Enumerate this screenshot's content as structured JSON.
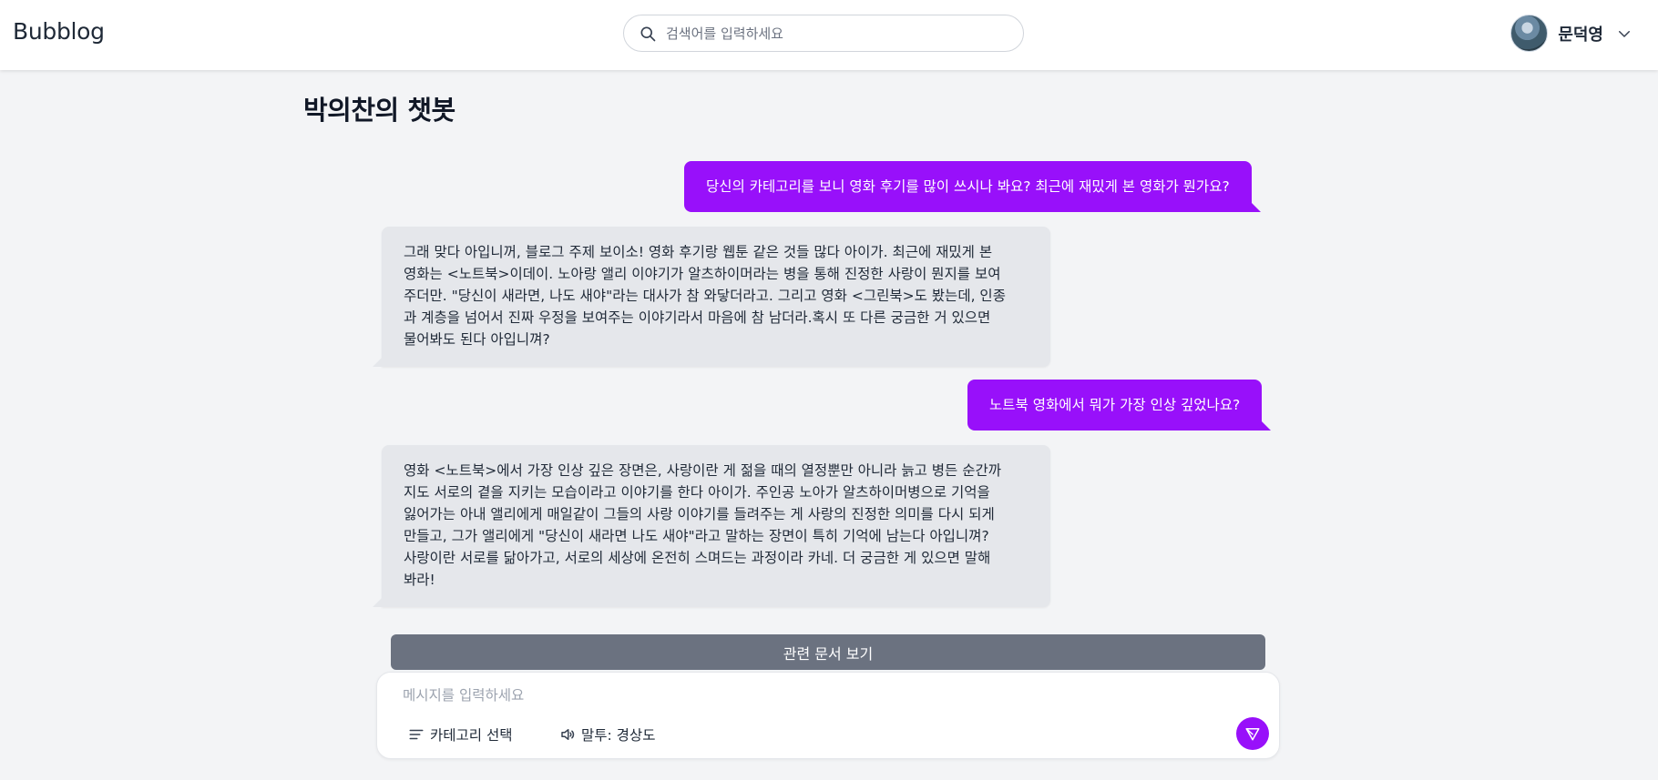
{
  "header": {
    "logo": "Bubblog",
    "search_placeholder": "검색어를 입력하세요",
    "user_name": "문덕영"
  },
  "page": {
    "title": "박의찬의 챗봇"
  },
  "messages": [
    {
      "role": "user",
      "text": "당신의 카테고리를 보니 영화 후기를 많이 쓰시나 봐요? 최근에 재밌게 본 영화가 뭔가요?"
    },
    {
      "role": "bot",
      "lines": [
        "그래 맞다 아입니꺼, 블로그 주제 보이소! 영화 후기랑 웹툰 같은 것들 많다 아이가. 최근에 재밌게 본",
        "영화는 <노트북>이데이. 노아랑 앨리 이야기가 알츠하이머라는 병을 통해 진정한 사랑이 뭔지를 보여",
        "주더만. \"당신이 새라면, 나도 새야\"라는 대사가 참 와닿더라고. 그리고 영화 <그린북>도 봤는데, 인종",
        "과 계층을 넘어서 진짜 우정을 보여주는 이야기라서 마음에 참 남더라.혹시 또 다른 궁금한 거 있으면",
        "물어봐도 된다 아입니껴?"
      ]
    },
    {
      "role": "user",
      "text": "노트북 영화에서 뭐가 가장 인상 깊었나요?"
    },
    {
      "role": "bot",
      "lines": [
        "영화 <노트북>에서 가장 인상 깊은 장면은, 사랑이란 게 젊을 때의 열정뿐만 아니라 늙고 병든 순간까",
        "지도 서로의 곁을 지키는 모습이라고 이야기를 한다 아이가. 주인공 노아가 알츠하이머병으로 기억을",
        "잃어가는 아내 앨리에게 매일같이 그들의 사랑 이야기를 들려주는 게 사랑의 진정한 의미를 다시 되게",
        "만들고, 그가 앨리에게 \"당신이 새라면 나도 새야\"라고 말하는 장면이 특히 기억에 남는다 아입니껴?",
        "사랑이란 서로를 닮아가고, 서로의 세상에 온전히 스며드는 과정이라 카네. 더 궁금한 게 있으면 말해",
        "봐라!"
      ]
    }
  ],
  "related_docs_button": "관련 문서 보기",
  "composer": {
    "placeholder": "메시지를 입력하세요",
    "category_label": "카테고리 선택",
    "tone_label": "말투: 경상도"
  },
  "colors": {
    "accent": "#9810fa",
    "bot_bubble": "#e5e7eb",
    "related_button": "#6b7280",
    "background": "#f3f4f6"
  },
  "icons": [
    "search-icon",
    "chevron-down-icon",
    "list-icon",
    "speaker-icon",
    "send-icon"
  ]
}
